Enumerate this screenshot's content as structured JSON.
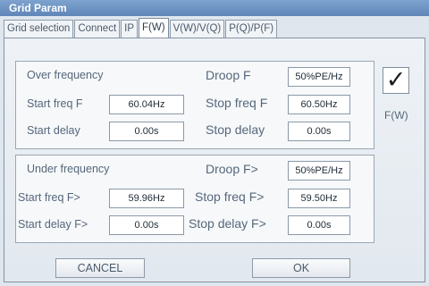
{
  "window": {
    "title": "Grid Param"
  },
  "tabs": [
    {
      "label": "Grid selection"
    },
    {
      "label": "Connect"
    },
    {
      "label": "IP"
    },
    {
      "label": "F(W)"
    },
    {
      "label": "V(W)/V(Q)"
    },
    {
      "label": "P(Q)/P(F)"
    }
  ],
  "active_tab": "F(W)",
  "over_frequency": {
    "title": "Over frequency",
    "droop_label": "Droop F",
    "droop_value": "50%PE/Hz",
    "start_freq_label": "Start freq F",
    "start_freq_value": "60.04Hz",
    "stop_freq_label": "Stop freq F",
    "stop_freq_value": "60.50Hz",
    "start_delay_label": "Start delay",
    "start_delay_value": "0.00s",
    "stop_delay_label": "Stop delay",
    "stop_delay_value": "0.00s"
  },
  "under_frequency": {
    "title": "Under frequency",
    "droop_label": "Droop F>",
    "droop_value": "50%PE/Hz",
    "start_freq_label": "Start freq F>",
    "start_freq_value": "59.96Hz",
    "stop_freq_label": "Stop freq F>",
    "stop_freq_value": "59.50Hz",
    "start_delay_label": "Start delay F>",
    "start_delay_value": "0.00s",
    "stop_delay_label": "Stop delay F>",
    "stop_delay_value": "0.00s"
  },
  "enable": {
    "checked": true,
    "mark": "✓",
    "label": "F(W)"
  },
  "buttons": {
    "cancel": "CANCEL",
    "ok": "OK"
  }
}
